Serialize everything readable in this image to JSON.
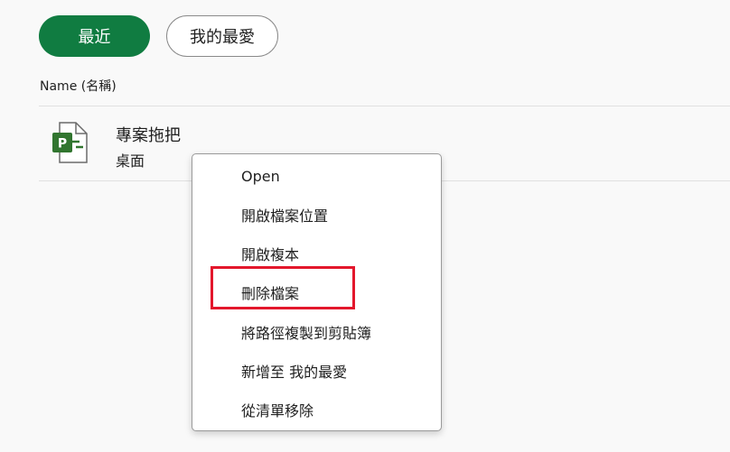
{
  "tabs": {
    "recent_label": "最近",
    "favorites_label": "我的最愛"
  },
  "list": {
    "column_header": "Name (名稱)",
    "files": [
      {
        "name": "專案拖把",
        "location": "桌面",
        "icon": "project-file-icon"
      }
    ]
  },
  "context_menu": {
    "items": [
      "Open",
      "開啟檔案位置",
      "開啟複本",
      "刪除檔案",
      "將路徑複製到剪貼簿",
      "新增至 我的最愛",
      "從清單移除"
    ],
    "highlighted_item": "刪除檔案"
  },
  "colors": {
    "accent": "#107c41",
    "highlight": "#e3172c",
    "project_icon": "#31752f"
  }
}
